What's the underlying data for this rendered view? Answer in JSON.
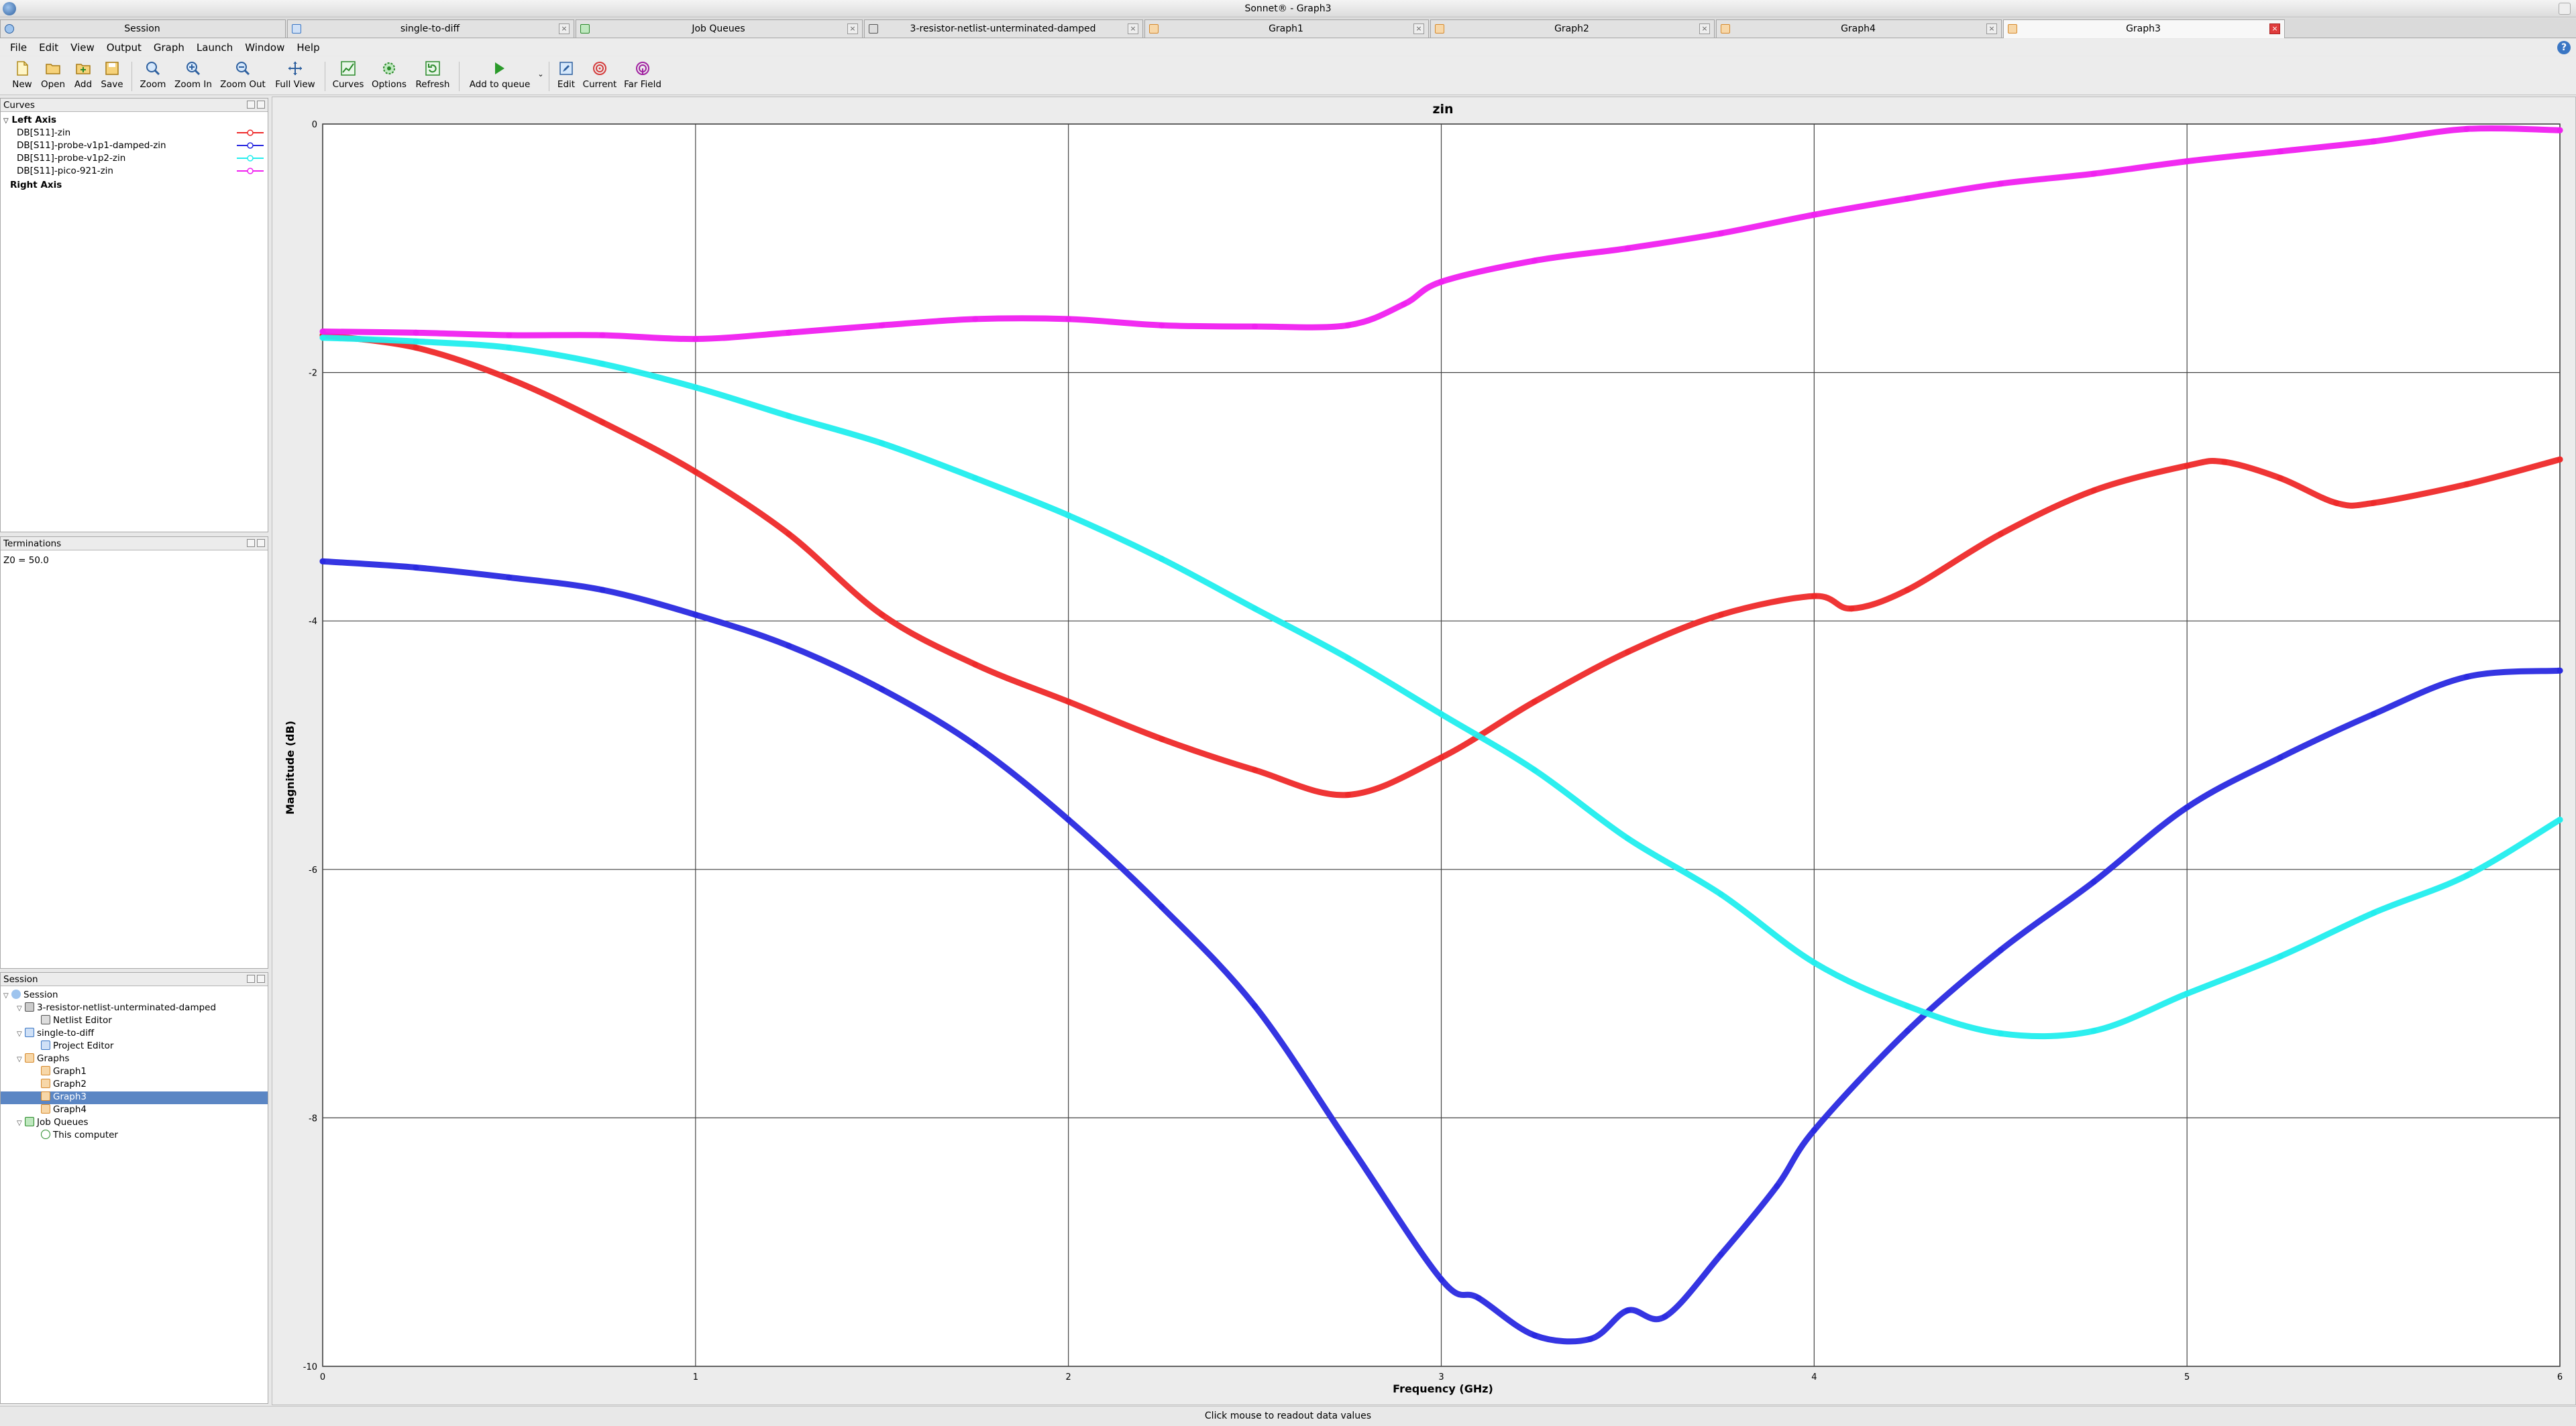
{
  "window": {
    "title": "Sonnet® - Graph3"
  },
  "tabs": [
    {
      "label": "Session",
      "active": false
    },
    {
      "label": "single-to-diff",
      "active": false
    },
    {
      "label": "Job Queues",
      "active": false
    },
    {
      "label": "3-resistor-netlist-unterminated-damped",
      "active": false
    },
    {
      "label": "Graph1",
      "active": false
    },
    {
      "label": "Graph2",
      "active": false
    },
    {
      "label": "Graph4",
      "active": false
    },
    {
      "label": "Graph3",
      "active": true
    }
  ],
  "menu": [
    "File",
    "Edit",
    "View",
    "Output",
    "Graph",
    "Launch",
    "Window",
    "Help"
  ],
  "toolbar": {
    "new": "New",
    "open": "Open",
    "add": "Add",
    "save": "Save",
    "zoom": "Zoom",
    "zoom_in": "Zoom In",
    "zoom_out": "Zoom Out",
    "full_view": "Full View",
    "curves": "Curves",
    "options": "Options",
    "refresh": "Refresh",
    "add_to_queue": "Add to queue",
    "edit": "Edit",
    "current": "Current",
    "far_field": "Far Field"
  },
  "curves_panel": {
    "title": "Curves",
    "left_axis": "Left Axis",
    "right_axis": "Right Axis",
    "items": [
      {
        "label": "DB[S11]-zin",
        "color": "#ee2a2a"
      },
      {
        "label": "DB[S11]-probe-v1p1-damped-zin",
        "color": "#2a2ae0"
      },
      {
        "label": "DB[S11]-probe-v1p2-zin",
        "color": "#22eeee"
      },
      {
        "label": "DB[S11]-pico-921-zin",
        "color": "#f020f0"
      }
    ]
  },
  "terminations_panel": {
    "title": "Terminations",
    "value": "Z0 = 50.0"
  },
  "session_panel": {
    "title": "Session",
    "tree": [
      {
        "label": "Session",
        "level": 0
      },
      {
        "label": "3-resistor-netlist-unterminated-damped",
        "level": 1
      },
      {
        "label": "Netlist Editor",
        "level": 2
      },
      {
        "label": "single-to-diff",
        "level": 1
      },
      {
        "label": "Project Editor",
        "level": 2
      },
      {
        "label": "Graphs",
        "level": 1
      },
      {
        "label": "Graph1",
        "level": 2
      },
      {
        "label": "Graph2",
        "level": 2
      },
      {
        "label": "Graph3",
        "level": 2,
        "selected": true
      },
      {
        "label": "Graph4",
        "level": 2
      },
      {
        "label": "Job Queues",
        "level": 1
      },
      {
        "label": "This computer",
        "level": 2
      }
    ]
  },
  "status": {
    "text": "Click mouse to readout data values"
  },
  "chart_data": {
    "type": "line",
    "title": "zin",
    "xlabel": "Frequency (GHz)",
    "ylabel": "Magnitude (dB)",
    "xlim": [
      0,
      6
    ],
    "ylim": [
      -10,
      0
    ],
    "x_ticks": [
      "0",
      "1",
      "2",
      "3",
      "4",
      "5",
      "6"
    ],
    "y_ticks": [
      "0",
      "-2",
      "-4",
      "-6",
      "-8",
      "-10"
    ],
    "grid": true,
    "legend": "Curves panel (left)",
    "series": [
      {
        "name": "DB[S11]-zin",
        "color": "#ee2a2a",
        "x": [
          0,
          0.25,
          0.5,
          0.75,
          1,
          1.25,
          1.5,
          1.75,
          2,
          2.25,
          2.5,
          2.75,
          3,
          3.25,
          3.5,
          3.75,
          4,
          4.1,
          4.25,
          4.5,
          4.75,
          5,
          5.1,
          5.25,
          5.4,
          5.5,
          5.75,
          6
        ],
        "y": [
          -1.7,
          -1.8,
          -2.05,
          -2.4,
          -2.8,
          -3.3,
          -3.95,
          -4.35,
          -4.65,
          -4.95,
          -5.2,
          -5.4,
          -5.1,
          -4.65,
          -4.25,
          -3.95,
          -3.8,
          -3.9,
          -3.75,
          -3.3,
          -2.95,
          -2.75,
          -2.72,
          -2.85,
          -3.05,
          -3.05,
          -2.9,
          -2.7
        ]
      },
      {
        "name": "DB[S11]-probe-v1p1-damped-zin",
        "color": "#2a2ae0",
        "x": [
          0,
          0.25,
          0.5,
          0.75,
          1,
          1.25,
          1.5,
          1.75,
          2,
          2.25,
          2.5,
          2.75,
          3,
          3.1,
          3.25,
          3.4,
          3.5,
          3.6,
          3.75,
          3.9,
          4,
          4.25,
          4.5,
          4.75,
          5,
          5.25,
          5.5,
          5.75,
          6
        ],
        "y": [
          -3.52,
          -3.57,
          -3.65,
          -3.75,
          -3.95,
          -4.2,
          -4.55,
          -5.0,
          -5.6,
          -6.3,
          -7.1,
          -8.2,
          -9.3,
          -9.45,
          -9.75,
          -9.78,
          -9.55,
          -9.6,
          -9.1,
          -8.55,
          -8.1,
          -7.3,
          -6.65,
          -6.1,
          -5.5,
          -5.1,
          -4.75,
          -4.45,
          -4.4
        ]
      },
      {
        "name": "DB[S11]-probe-v1p2-zin",
        "color": "#22eeee",
        "x": [
          0,
          0.25,
          0.5,
          0.75,
          1,
          1.25,
          1.5,
          1.75,
          2,
          2.25,
          2.5,
          2.75,
          3,
          3.25,
          3.5,
          3.75,
          4,
          4.25,
          4.5,
          4.75,
          5,
          5.25,
          5.5,
          5.75,
          6
        ],
        "y": [
          -1.72,
          -1.75,
          -1.8,
          -1.93,
          -2.12,
          -2.35,
          -2.57,
          -2.85,
          -3.15,
          -3.5,
          -3.9,
          -4.3,
          -4.75,
          -5.2,
          -5.75,
          -6.2,
          -6.75,
          -7.1,
          -7.32,
          -7.3,
          -7.0,
          -6.7,
          -6.35,
          -6.05,
          -5.6
        ]
      },
      {
        "name": "DB[S11]-pico-921-zin",
        "color": "#f020f0",
        "x": [
          0,
          0.25,
          0.5,
          0.75,
          1,
          1.25,
          1.5,
          1.75,
          2,
          2.25,
          2.5,
          2.75,
          2.9,
          3,
          3.25,
          3.5,
          3.75,
          4,
          4.25,
          4.5,
          4.75,
          5,
          5.25,
          5.5,
          5.75,
          6
        ],
        "y": [
          -1.67,
          -1.68,
          -1.7,
          -1.7,
          -1.73,
          -1.68,
          -1.62,
          -1.57,
          -1.57,
          -1.62,
          -1.63,
          -1.62,
          -1.45,
          -1.27,
          -1.1,
          -1.0,
          -0.88,
          -0.73,
          -0.6,
          -0.48,
          -0.4,
          -0.3,
          -0.22,
          -0.14,
          -0.04,
          -0.05
        ]
      }
    ]
  }
}
